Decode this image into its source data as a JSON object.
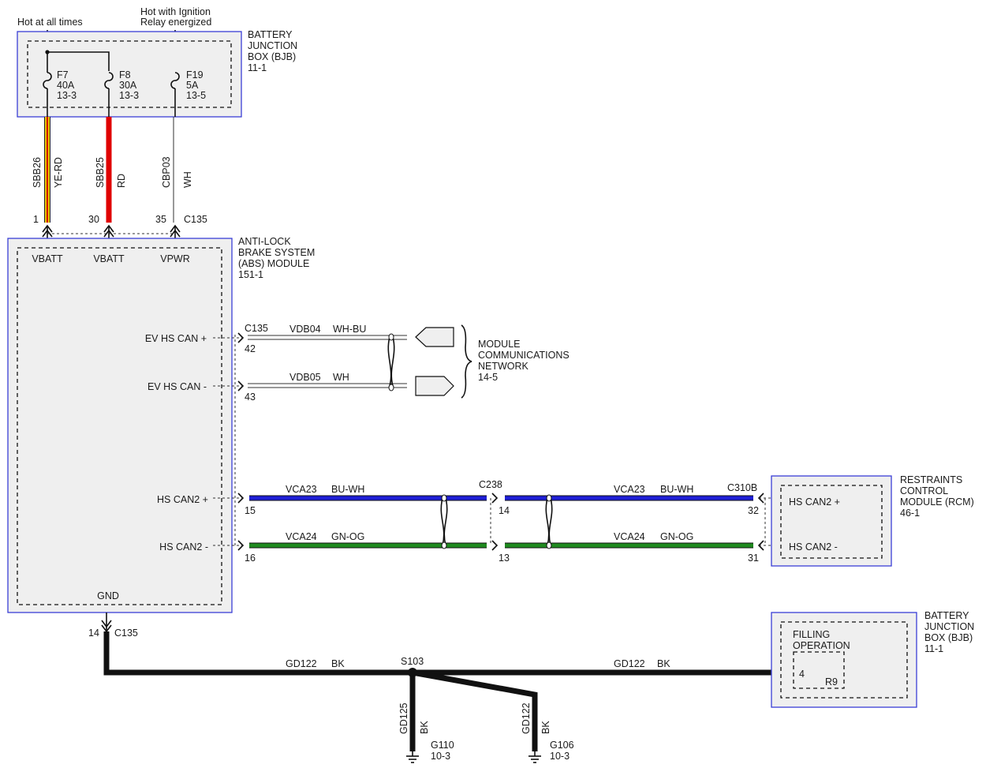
{
  "header": {
    "hot_at_all_times": "Hot at all times",
    "hot_ignition_line1": "Hot with Ignition",
    "hot_ignition_line2": "Relay energized"
  },
  "bjb_top": {
    "title": [
      "BATTERY",
      "JUNCTION",
      "BOX (BJB)"
    ],
    "ref": "11-1",
    "fuses": [
      {
        "name": "F7",
        "rating": "40A",
        "ref": "13-3"
      },
      {
        "name": "F8",
        "rating": "30A",
        "ref": "13-3"
      },
      {
        "name": "F19",
        "rating": "5A",
        "ref": "13-5"
      }
    ]
  },
  "power_wires": [
    {
      "circuit": "SBB26",
      "color": "YE-RD",
      "pin": "1",
      "terminal": "VBATT",
      "stroke": "#e8c800",
      "stripe": "#d40000"
    },
    {
      "circuit": "SBB25",
      "color": "RD",
      "pin": "30",
      "terminal": "VBATT",
      "stroke": "#e00000"
    },
    {
      "circuit": "CBP03",
      "color": "WH",
      "pin": "35",
      "terminal": "VPWR",
      "stroke": "#ffffff"
    }
  ],
  "connector_c135": "C135",
  "abs_module": {
    "title": [
      "ANTI-LOCK",
      "BRAKE SYSTEM",
      "(ABS) MODULE"
    ],
    "ref": "151-1",
    "pins": {
      "ev_can_plus": "EV HS CAN +",
      "ev_can_minus": "EV HS CAN -",
      "hs_can2_plus": "HS CAN2 +",
      "hs_can2_minus": "HS CAN2 -",
      "gnd": "GND"
    }
  },
  "ev_can": {
    "connector": "C135",
    "wires": [
      {
        "circuit": "VDB04",
        "color": "WH-BU",
        "pin": "42"
      },
      {
        "circuit": "VDB05",
        "color": "WH",
        "pin": "43"
      }
    ],
    "network": [
      "MODULE",
      "COMMUNICATIONS",
      "NETWORK"
    ],
    "network_ref": "14-5"
  },
  "hs_can2": {
    "mid_connector": "C238",
    "rcm_connector": "C310B",
    "wires": [
      {
        "circuit": "VCA23",
        "color": "BU-WH",
        "abs_pin": "15",
        "mid_pin": "14",
        "rcm_pin": "32",
        "stroke": "#1f1fd6"
      },
      {
        "circuit": "VCA24",
        "color": "GN-OG",
        "abs_pin": "16",
        "mid_pin": "13",
        "rcm_pin": "31",
        "stroke": "#1f8a1f"
      }
    ]
  },
  "rcm": {
    "title": [
      "RESTRAINTS",
      "CONTROL",
      "MODULE (RCM)"
    ],
    "ref": "46-1",
    "pin_plus": "HS CAN2 +",
    "pin_minus": "HS CAN2 -"
  },
  "ground": {
    "pin": "14",
    "connector": "C135",
    "splice": "S103",
    "main_circuit": "GD122",
    "main_color": "BK",
    "branches": [
      {
        "circuit": "GD125",
        "color": "BK",
        "ground": "G110",
        "ref": "10-3"
      },
      {
        "circuit": "GD122",
        "color": "BK",
        "ground": "G106",
        "ref": "10-3"
      }
    ]
  },
  "bjb_bottom": {
    "title": [
      "BATTERY",
      "JUNCTION",
      "BOX (BJB)"
    ],
    "ref": "11-1",
    "inner_title": [
      "FILLING",
      "OPERATION"
    ],
    "pin": "4",
    "component": "R9"
  }
}
